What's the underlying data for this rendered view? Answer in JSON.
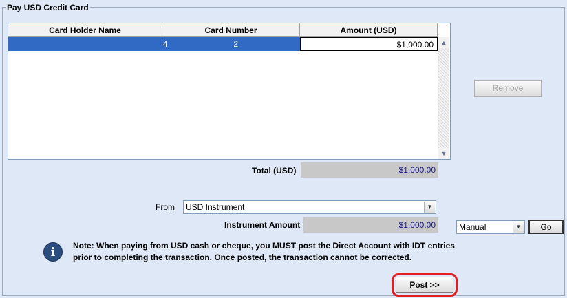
{
  "group": {
    "title": "Pay USD Credit Card"
  },
  "grid": {
    "columns": [
      "Card Holder Name",
      "Card Number",
      "Amount (USD)"
    ],
    "rows": [
      {
        "card_holder_name": "",
        "card_number_left": "4",
        "card_number_right": "2",
        "amount": "$1,000.00"
      }
    ],
    "scroll_up": "▲",
    "scroll_down": "▼"
  },
  "buttons": {
    "remove": "Remove",
    "go": "Go",
    "post": "Post >>"
  },
  "total": {
    "label": "Total (USD)",
    "value": "$1,000.00"
  },
  "from": {
    "label": "From",
    "value": "USD Instrument"
  },
  "instrument_amount": {
    "label": "Instrument Amount",
    "value": "$1,000.00"
  },
  "mode": {
    "value": "Manual"
  },
  "note": {
    "text": "Note: When paying from USD cash or cheque, you MUST post the Direct Account with IDT entries prior to completing the transaction. Once posted, the transaction cannot be corrected."
  },
  "icons": {
    "info": "info-icon",
    "dropdown": "chevron-down-icon"
  },
  "colors": {
    "selection": "#316ac5",
    "highlight": "#e02020",
    "background": "#dfe8f6"
  }
}
